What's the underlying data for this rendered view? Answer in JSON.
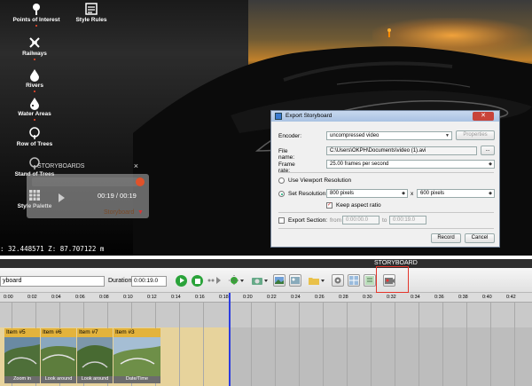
{
  "layers": [
    {
      "label": "Points of Interest",
      "icon": "points-of-interest-icon"
    },
    {
      "label": "Style Rules",
      "icon": "style-rules-icon"
    },
    {
      "label": "Railways",
      "icon": "railways-icon"
    },
    {
      "label": "Rivers",
      "icon": "rivers-icon"
    },
    {
      "label": "Water Areas",
      "icon": "water-areas-icon"
    },
    {
      "label": "Row of Trees",
      "icon": "row-of-trees-icon"
    },
    {
      "label": "Stand of Trees",
      "icon": "stand-of-trees-icon"
    },
    {
      "label": "Style Palette",
      "icon": "style-palette-icon"
    }
  ],
  "player": {
    "tab_label": "STORYBOARDS",
    "time": "00:19  /  00:19",
    "storyboard_label": "Storyboard"
  },
  "coords": ": 32.448571  Z: 87.707122  m",
  "dialog": {
    "title": "Export Storyboard",
    "close": "✕",
    "encoder_label": "Encoder:",
    "encoder_value": "uncompressed video",
    "properties": "Properties",
    "filename_label": "File name:",
    "filename_value": "C:\\Users\\OKPH\\Documents\\video (1).avi",
    "browse": "...",
    "framerate_label": "Frame rate:",
    "framerate_value": "25.00 frames per second",
    "viewport_label": "Use Viewport Resolution",
    "setres_label": "Set Resolution:",
    "width_value": "800 pixels",
    "times": "x",
    "height_value": "600 pixels",
    "keep_aspect": "Keep aspect ratio",
    "export_section": "Export Section:",
    "from": "from",
    "from_value": "0:00:00.0",
    "to": "to",
    "to_value": "0:00:19.0",
    "record": "Record",
    "cancel": "Cancel"
  },
  "storyboard": {
    "header": "STORYBOARD",
    "name": "yboard",
    "duration_label": "Duration:",
    "duration_value": "0:00:19.0"
  },
  "ruler": [
    "0:00",
    "0:02",
    "0:04",
    "0:06",
    "0:08",
    "0:10",
    "0:12",
    "0:14",
    "0:16",
    "0:18",
    "0:20",
    "0:22",
    "0:24",
    "0:26",
    "0:28",
    "0:30",
    "0:32",
    "0:34",
    "0:36",
    "0:38",
    "0:40",
    "0:42"
  ],
  "clips": [
    {
      "label": "Item #5",
      "caption": "Zoom in"
    },
    {
      "label": "Item #6",
      "caption": "Look around"
    },
    {
      "label": "Item #7",
      "caption": "Look around"
    },
    {
      "label": "Item #3",
      "caption": "Date/Time"
    }
  ],
  "colors": {
    "accent": "#2aa33a",
    "record_highlight": "#e4352a",
    "clip": "#e3b33c",
    "playhead": "#2c3de0"
  }
}
